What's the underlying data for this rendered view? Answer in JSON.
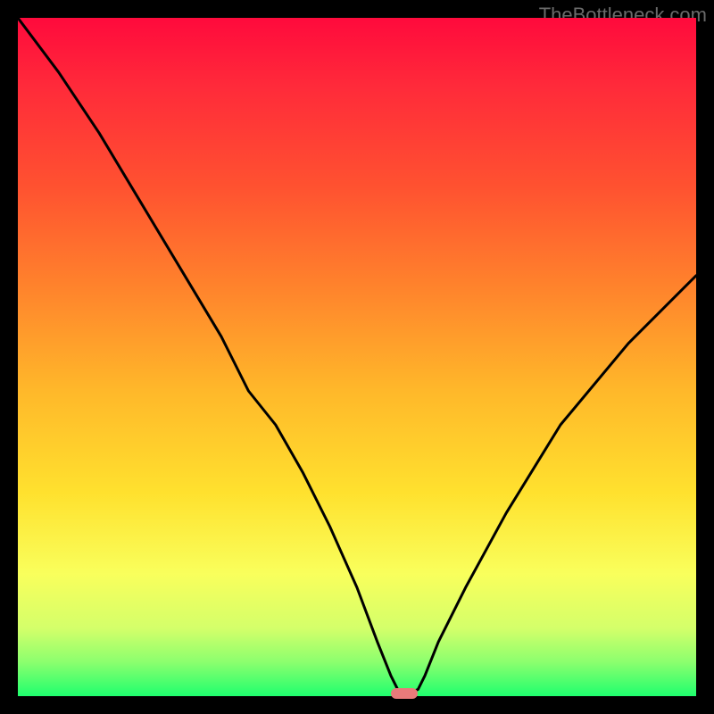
{
  "watermark": "TheBottleneck.com",
  "domain_note": "Bottleneck deviation curve",
  "chart_data": {
    "type": "line",
    "title": "",
    "xlabel": "",
    "ylabel": "",
    "xlim": [
      0,
      100
    ],
    "ylim": [
      0,
      100
    ],
    "series": [
      {
        "name": "bottleneck-curve",
        "x": [
          0,
          6,
          12,
          18,
          24,
          30,
          34,
          38,
          42,
          46,
          50,
          53,
          55,
          56,
          57,
          58,
          59,
          60,
          62,
          66,
          72,
          80,
          90,
          100
        ],
        "values": [
          100,
          92,
          83,
          73,
          63,
          53,
          45,
          40,
          33,
          25,
          16,
          8,
          3,
          1,
          0.5,
          0.5,
          1,
          3,
          8,
          16,
          27,
          40,
          52,
          62
        ]
      }
    ],
    "optimal_marker": {
      "x": 57,
      "y": 0.4,
      "w": 4,
      "h": 1.5,
      "color": "#e97a7a"
    }
  },
  "gradient_colors": {
    "top": "#ff0a3c",
    "mid_upper": "#ff842c",
    "mid": "#ffe12e",
    "lower": "#d4ff6a",
    "bottom": "#1fff6e"
  }
}
